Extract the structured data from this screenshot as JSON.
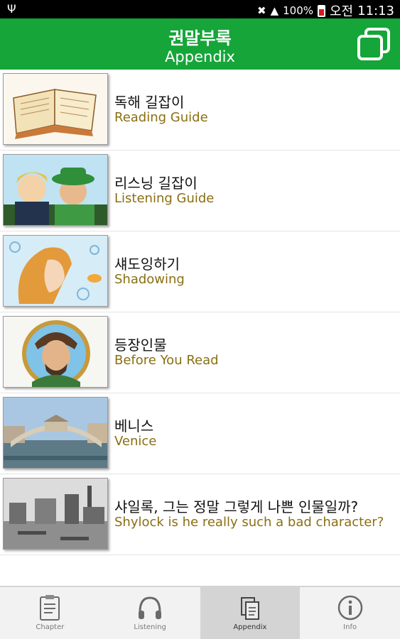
{
  "status_bar": {
    "battery_percent": "100%",
    "ampm": "오전",
    "time": "11:13",
    "usb_icon": "usb-icon",
    "mute_icon": "mute-icon",
    "wifi_icon": "wifi-icon",
    "battery_icon": "battery-icon"
  },
  "header": {
    "title_ko": "권말부록",
    "title_en": "Appendix",
    "action_icon": "copy-pages-icon",
    "background": "#16a539"
  },
  "list": {
    "items": [
      {
        "title": "독해 길잡이",
        "subtitle": "Reading Guide",
        "thumb": "open-book-illustration"
      },
      {
        "title": "리스닝 길잡이",
        "subtitle": "Listening Guide",
        "thumb": "two-men-illustration"
      },
      {
        "title": "섀도잉하기",
        "subtitle": "Shadowing",
        "thumb": "woman-illustration"
      },
      {
        "title": "등장인물",
        "subtitle": "Before You Read",
        "thumb": "portrait-illustration"
      },
      {
        "title": "베니스",
        "subtitle": "Venice",
        "thumb": "rialto-bridge-photo"
      },
      {
        "title": "샤일록, 그는 정말 그렇게 나쁜 인물일까?",
        "subtitle": "Shylock is he really such a bad character?",
        "thumb": "venice-historic-photo"
      }
    ],
    "subtitle_color": "#8a6f12"
  },
  "bottom_nav": {
    "tabs": [
      {
        "label": "Chapter",
        "icon": "clipboard-icon"
      },
      {
        "label": "Listening",
        "icon": "headphones-icon"
      },
      {
        "label": "Appendix",
        "icon": "documents-icon",
        "active": true
      },
      {
        "label": "Info",
        "icon": "info-icon"
      }
    ]
  }
}
